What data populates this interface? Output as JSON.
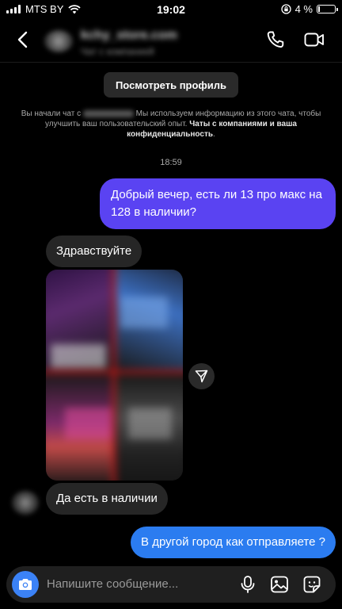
{
  "status_bar": {
    "carrier": "MTS BY",
    "time": "19:02",
    "battery": "4 %",
    "battery_level": 0.04
  },
  "header": {
    "contact_name": "kchy_store.com",
    "contact_subtitle": "Чат с компанией"
  },
  "profile_button": "Посмотреть профиль",
  "notice": {
    "part1": "Вы начали чат с",
    "part2": "Мы используем информацию из этого чата, чтобы улучшить ваш пользовательский опыт.",
    "link1": "Чаты с компаниями и ваша конфиденциальность",
    "end": "."
  },
  "timestamp": "18:59",
  "messages": [
    {
      "direction": "outgoing",
      "text": "Добрый вечер, есть ли 13 про макс на 128 в наличии?"
    },
    {
      "direction": "incoming",
      "text": "Здравствуйте"
    },
    {
      "direction": "incoming",
      "type": "photo"
    },
    {
      "direction": "incoming",
      "text": "Да есть в наличии"
    },
    {
      "direction": "outgoing",
      "text": "В другой город как отправляете ?"
    }
  ],
  "composer": {
    "placeholder": "Напишите сообщение..."
  },
  "colors": {
    "outgoing_purple": "#5a43f2",
    "outgoing_blue": "#2b7cf0",
    "incoming": "#262626",
    "camera": "#3b82f6"
  }
}
